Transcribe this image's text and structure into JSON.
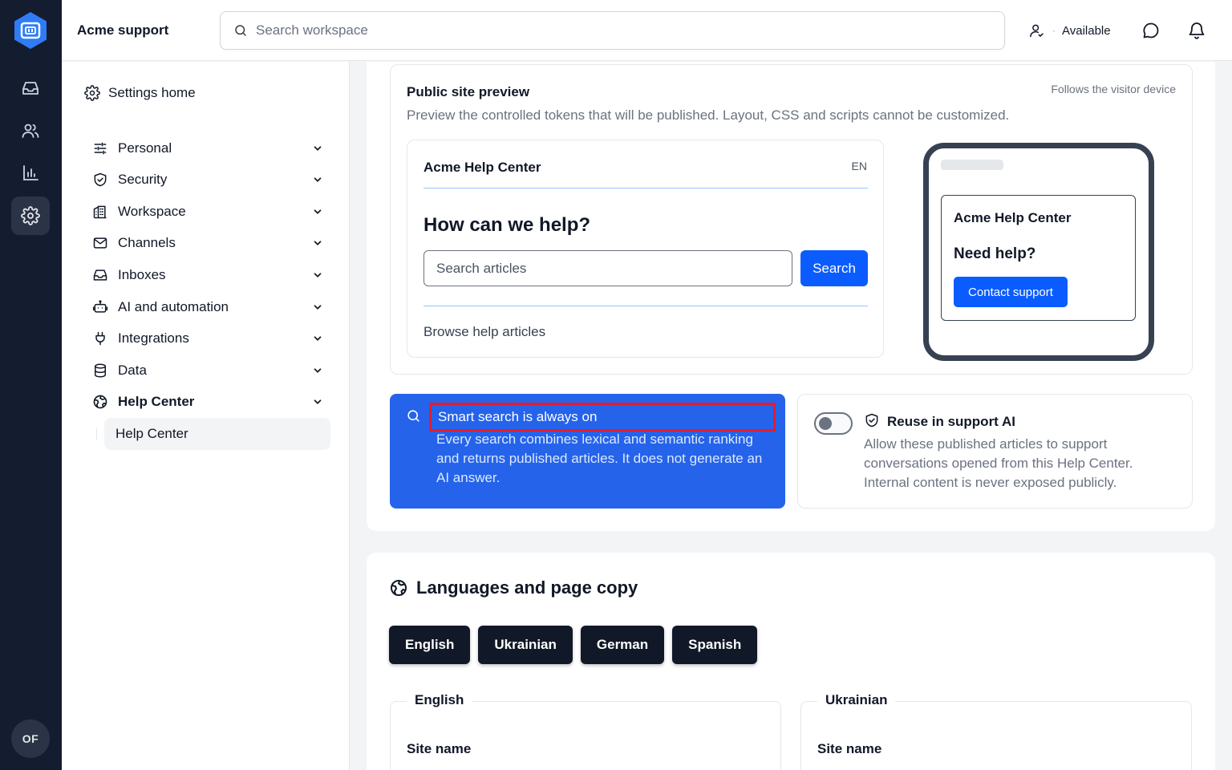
{
  "app": {
    "title": "Acme support",
    "avatar_initials": "OF"
  },
  "search": {
    "placeholder": "Search workspace"
  },
  "status": {
    "label": "Available"
  },
  "rail": {
    "items": [
      "inbox-icon",
      "users-icon",
      "chart-icon",
      "gear-icon"
    ],
    "active": "gear-icon"
  },
  "nav": {
    "home": "Settings home",
    "items": [
      {
        "label": "Personal",
        "icon": "sliders-icon"
      },
      {
        "label": "Security",
        "icon": "shield-icon"
      },
      {
        "label": "Workspace",
        "icon": "building-icon"
      },
      {
        "label": "Channels",
        "icon": "mail-icon"
      },
      {
        "label": "Inboxes",
        "icon": "inbox-icon"
      },
      {
        "label": "AI and automation",
        "icon": "robot-icon"
      },
      {
        "label": "Integrations",
        "icon": "plug-icon"
      },
      {
        "label": "Data",
        "icon": "database-icon"
      },
      {
        "label": "Help Center",
        "icon": "globe-icon"
      }
    ],
    "sub_item": "Help Center"
  },
  "preview": {
    "title": "Public site preview",
    "note": "Follows the visitor device",
    "description": "Preview the controlled tokens that will be published. Layout, CSS and scripts cannot be customized.",
    "desktop": {
      "site_title": "Acme Help Center",
      "lang": "EN",
      "hero": "How can we help?",
      "search_placeholder": "Search articles",
      "search_button": "Search",
      "browse": "Browse help articles"
    },
    "mobile": {
      "site_title": "Acme Help Center",
      "hero": "Need help?",
      "button": "Contact support"
    }
  },
  "smart_search": {
    "title": "Smart search is always on",
    "body": "Every search combines lexical and semantic ranking and returns published articles. It does not generate an AI answer."
  },
  "reuse_ai": {
    "title": "Reuse in support AI",
    "body": "Allow these published articles to support conversations opened from this Help Center. Internal content is never exposed publicly.",
    "enabled": false
  },
  "languages": {
    "title": "Languages and page copy",
    "tabs": [
      "English",
      "Ukrainian",
      "German",
      "Spanish"
    ],
    "sections": [
      {
        "legend": "English",
        "field_label": "Site name"
      },
      {
        "legend": "Ukrainian",
        "field_label": "Site name"
      }
    ]
  },
  "colors": {
    "rail": "#141c2f",
    "primary": "#0b5cff",
    "smart_card": "#2563eb",
    "highlight": "#e11d2e"
  }
}
